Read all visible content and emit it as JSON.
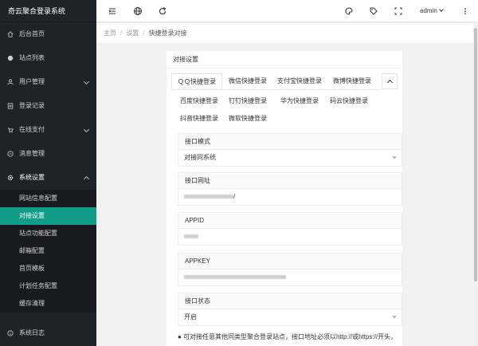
{
  "app": {
    "title": "奇云聚合登录系统"
  },
  "sidebar": {
    "items": [
      {
        "label": "后台首页",
        "icon": "home-icon"
      },
      {
        "label": "站点列表",
        "icon": "globe-icon"
      },
      {
        "label": "用户管理",
        "icon": "user-icon",
        "expandable": true
      },
      {
        "label": "登录记录",
        "icon": "list-icon"
      },
      {
        "label": "在线支付",
        "icon": "cart-icon",
        "expandable": true
      },
      {
        "label": "消息管理",
        "icon": "message-icon"
      },
      {
        "label": "系统设置",
        "icon": "gear-icon",
        "expandable": true,
        "open": true
      }
    ],
    "sub_items": [
      "网站信息配置",
      "对接设置",
      "站点功能配置",
      "邮箱配置",
      "首页模板",
      "计划任务配置",
      "缓存清理"
    ],
    "active_sub": "对接设置",
    "bottom_item": {
      "label": "系统日志",
      "icon": "info-icon"
    }
  },
  "header": {
    "user": "admin"
  },
  "breadcrumb": {
    "home": "主页",
    "section": "设置",
    "current": "快捷登录对接"
  },
  "card": {
    "title": "对接设置",
    "tabs": [
      "ＱＱ快捷登录",
      "微信快捷登录",
      "支付宝快捷登录",
      "微博快捷登录",
      "百度快捷登录",
      "钉钉快捷登录",
      "华为快捷登录",
      "码云快捷登录",
      "抖音快捷登录",
      "微软快捷登录"
    ],
    "active_tab": "ＱＱ快捷登录",
    "fields": {
      "mode": {
        "label": "接口模式",
        "value": "对接同系统"
      },
      "url": {
        "label": "接口网址",
        "value_suffix": "/"
      },
      "appid": {
        "label": "APPID"
      },
      "appkey": {
        "label": "APPKEY"
      },
      "status": {
        "label": "接口状态",
        "value": "开启"
      }
    },
    "note": "● 可对接任意其他同类型聚合登录站点，接口地址必须以http://或https://开头，"
  },
  "colors": {
    "sidebar_bg": "#20222a",
    "active": "#119d88"
  }
}
